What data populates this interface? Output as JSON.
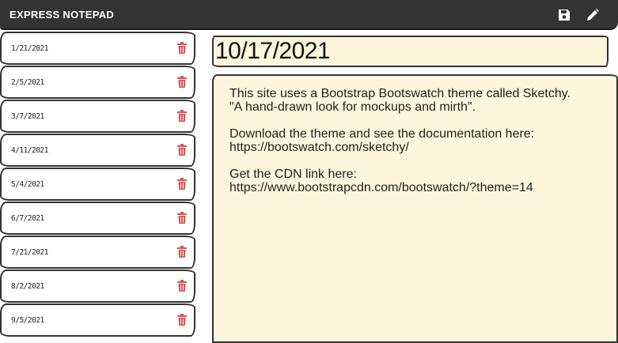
{
  "navbar": {
    "brand": "EXPRESS NOTEPAD",
    "icons": [
      "save-icon",
      "pencil-icon"
    ]
  },
  "notes": [
    {
      "date": "1/21/2021"
    },
    {
      "date": "2/5/2021"
    },
    {
      "date": "3/7/2021"
    },
    {
      "date": "4/11/2021"
    },
    {
      "date": "5/4/2021"
    },
    {
      "date": "6/7/2021"
    },
    {
      "date": "7/21/2021"
    },
    {
      "date": "8/2/2021"
    },
    {
      "date": "9/5/2021"
    }
  ],
  "editor": {
    "title": "10/17/2021",
    "paragraphs": [
      "This site uses a Bootstrap Bootswatch theme called Sketchy.\n\"A hand-drawn look for mockups and mirth\".",
      "Download the theme and see the documentation here:\nhttps://bootswatch.com/sketchy/",
      "Get the CDN link here:\nhttps://www.bootstrapcdn.com/bootswatch/?theme=14"
    ]
  },
  "colors": {
    "navbar": "#333333",
    "note_background": "#fbf6dc",
    "trash": "#d9534f"
  }
}
